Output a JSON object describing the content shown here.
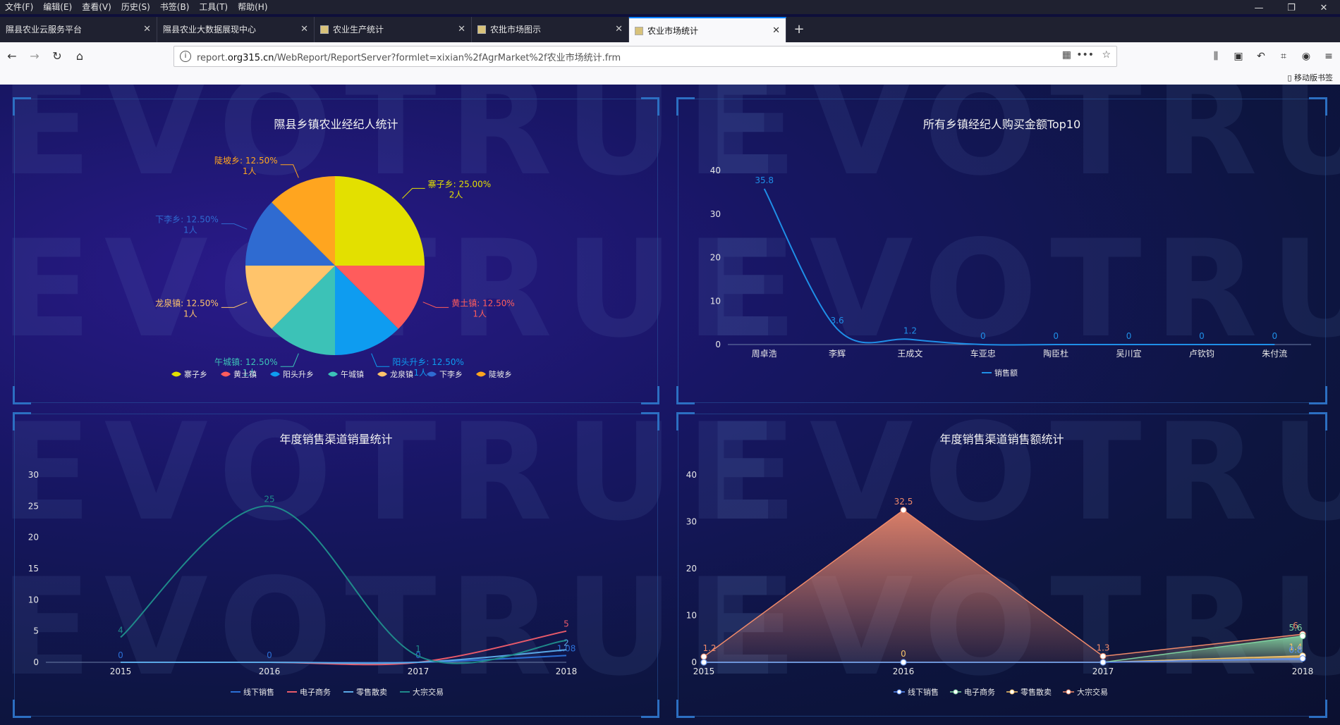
{
  "menu": [
    "文件(F)",
    "编辑(E)",
    "查看(V)",
    "历史(S)",
    "书签(B)",
    "工具(T)",
    "帮助(H)"
  ],
  "window_controls": {
    "minimize": "—",
    "restore": "❐",
    "close": "✕"
  },
  "tabs": [
    {
      "label": "隰县农业云服务平台",
      "active": false
    },
    {
      "label": "隰县农业大数据展现中心",
      "active": false
    },
    {
      "label": "农业生产统计",
      "active": false
    },
    {
      "label": "农批市场图示",
      "active": false
    },
    {
      "label": "农业市场统计",
      "active": true
    }
  ],
  "new_tab_label": "+",
  "address": {
    "prefix": "report.",
    "domain": "org315.cn",
    "path": "/WebReport/ReportServer?formlet=xixian%2fAgrMarket%2f农业市场统计.frm"
  },
  "bookmarks_bar": {
    "mobile": "移动版书签"
  },
  "icons": {
    "back": "back-arrow-icon",
    "forward": "forward-arrow-icon",
    "reload": "reload-icon",
    "home": "home-icon",
    "info": "info-icon",
    "qr": "qr-code-icon",
    "more": "more-icon",
    "star": "star-icon",
    "library": "library-icon",
    "sidebar": "sidebar-icon",
    "undo": "undo-icon",
    "crop": "screenshot-icon",
    "chat": "chat-icon",
    "menu": "hamburger-menu-icon"
  },
  "watermark": "EVOTRUE",
  "colors": {
    "accent": "#0a84ff",
    "pie": [
      "#e3e000",
      "#ff5c5c",
      "#0e9cf0",
      "#3cc2b7",
      "#ffc46b",
      "#2f6bd1",
      "#ffa51f"
    ]
  },
  "chart_data": [
    {
      "type": "pie",
      "title": "隰县乡镇农业经纪人统计",
      "slices": [
        {
          "name": "寨子乡",
          "value": 2,
          "label": "寨子乡: 25.00%",
          "sub": "2人"
        },
        {
          "name": "黄土镇",
          "value": 1,
          "label": "黄土镇: 12.50%",
          "sub": "1人"
        },
        {
          "name": "阳头升乡",
          "value": 1,
          "label": "阳头升乡: 12.50%",
          "sub": "1人"
        },
        {
          "name": "午城镇",
          "value": 1,
          "label": "午城镇: 12.50%",
          "sub": "1人"
        },
        {
          "name": "龙泉镇",
          "value": 1,
          "label": "龙泉镇: 12.50%",
          "sub": "1人"
        },
        {
          "name": "下李乡",
          "value": 1,
          "label": "下李乡: 12.50%",
          "sub": "1人"
        },
        {
          "name": "陡坡乡",
          "value": 1,
          "label": "陡坡乡: 12.50%",
          "sub": "1人"
        }
      ],
      "legend": [
        "寨子乡",
        "黄土镇",
        "阳头升乡",
        "午城镇",
        "龙泉镇",
        "下李乡",
        "陡坡乡"
      ]
    },
    {
      "type": "line",
      "title": "所有乡镇经纪人购买金额Top10",
      "categories": [
        "周卓浩",
        "李辉",
        "王成文",
        "车亚忠",
        "陶臣杜",
        "吴川宜",
        "卢钦钧",
        "朱付流"
      ],
      "series": [
        {
          "name": "销售额",
          "values": [
            35.8,
            3.6,
            1.2,
            0,
            0,
            0,
            0,
            0
          ],
          "color": "#1f8fe8"
        }
      ],
      "yticks": [
        0,
        10,
        20,
        30,
        40
      ],
      "ylim": [
        0,
        40
      ]
    },
    {
      "type": "line",
      "title": "年度销售渠道销量统计",
      "categories": [
        "2015",
        "2016",
        "2017",
        "2018"
      ],
      "series": [
        {
          "name": "线下销售",
          "values": [
            0,
            0,
            0,
            1.08
          ],
          "color": "#2b6fd6",
          "labels": [
            "0",
            "0",
            "0",
            "1.08"
          ]
        },
        {
          "name": "电子商务",
          "values": [
            0,
            0,
            0,
            5
          ],
          "color": "#e85a6a",
          "labels": [
            "",
            "",
            "",
            "5"
          ]
        },
        {
          "name": "零售散卖",
          "values": [
            0,
            0,
            0,
            2
          ],
          "color": "#5aa8e6",
          "labels": [
            "",
            "",
            "",
            "2"
          ]
        },
        {
          "name": "大宗交易",
          "values": [
            4,
            25,
            1,
            3.5
          ],
          "color": "#1f8a8a",
          "labels": [
            "4",
            "25",
            "1",
            ""
          ]
        }
      ],
      "yticks": [
        0,
        5,
        10,
        15,
        20,
        25,
        30
      ],
      "ylim": [
        0,
        30
      ]
    },
    {
      "type": "area",
      "title": "年度销售渠道销售额统计",
      "categories": [
        "2015",
        "2016",
        "2017",
        "2018"
      ],
      "series": [
        {
          "name": "线下销售",
          "values": [
            0,
            0,
            0,
            0.8
          ],
          "color": "#5b8ff9",
          "labels": [
            "",
            "",
            "",
            "0.8"
          ]
        },
        {
          "name": "电子商务",
          "values": [
            0,
            0,
            0,
            5.6
          ],
          "color": "#7ed3a0",
          "labels": [
            "",
            "",
            "",
            "5.6"
          ]
        },
        {
          "name": "零售散卖",
          "values": [
            0,
            0,
            0,
            1.4
          ],
          "color": "#f6c46b",
          "labels": [
            "",
            "0",
            "",
            "1.4"
          ]
        },
        {
          "name": "大宗交易",
          "values": [
            1.2,
            32.5,
            1.3,
            6
          ],
          "color": "#f08a6a",
          "labels": [
            "1.2",
            "32.5",
            "1.3",
            "6"
          ]
        }
      ],
      "yticks": [
        0,
        10,
        20,
        30,
        40
      ],
      "ylim": [
        0,
        40
      ]
    }
  ]
}
